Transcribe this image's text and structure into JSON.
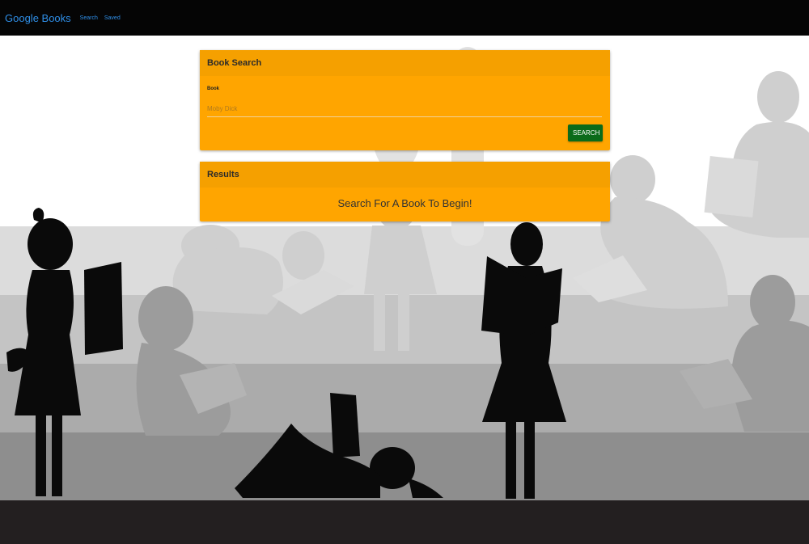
{
  "navbar": {
    "brand": "Google Books",
    "links": [
      "Search",
      "Saved"
    ]
  },
  "search_card": {
    "title": "Book Search",
    "field_label": "Book",
    "input_value": "",
    "input_placeholder": "Moby Dick",
    "button_label": "SEARCH"
  },
  "results_card": {
    "title": "Results",
    "message": "Search For A Book To Begin!"
  },
  "colors": {
    "navbar": "#050505",
    "brand_link": "#2f8fe8",
    "card": "#ffa500",
    "button": "#0b6b1a"
  }
}
